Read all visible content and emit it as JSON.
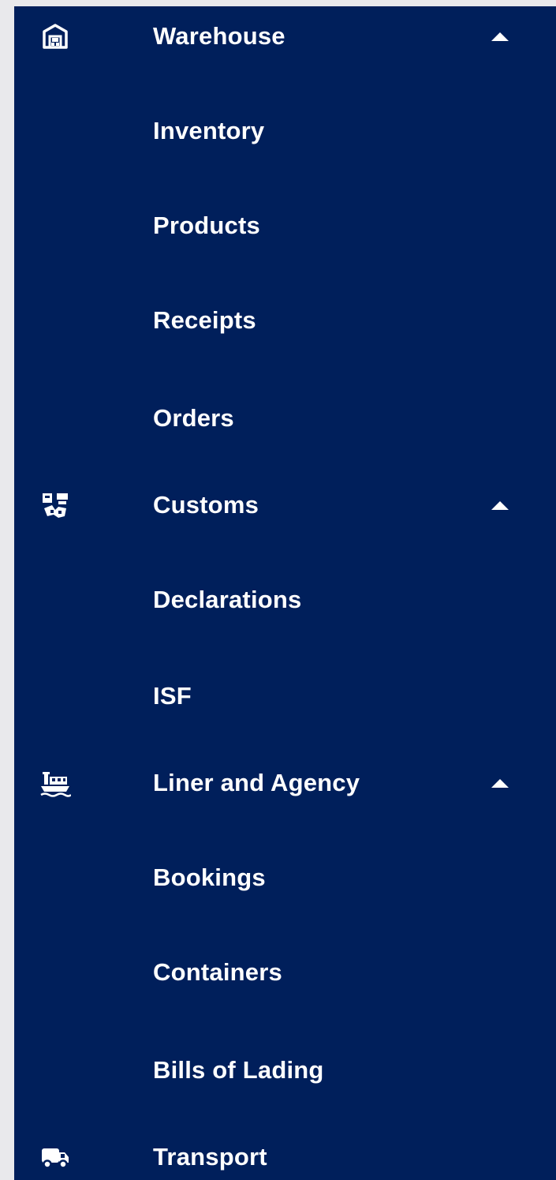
{
  "colors": {
    "panel_background": "#001f5b",
    "page_background": "#e9e9ec",
    "text": "#ffffff"
  },
  "nav": {
    "warehouse": {
      "label": "Warehouse",
      "icon": "warehouse-icon",
      "expanded": true,
      "children": [
        {
          "label": "Inventory"
        },
        {
          "label": "Products"
        },
        {
          "label": "Receipts"
        },
        {
          "label": "Orders"
        }
      ]
    },
    "customs": {
      "label": "Customs",
      "icon": "customs-icon",
      "expanded": true,
      "children": [
        {
          "label": "Declarations"
        },
        {
          "label": "ISF"
        }
      ]
    },
    "liner": {
      "label": "Liner and Agency",
      "icon": "ship-icon",
      "expanded": true,
      "children": [
        {
          "label": "Bookings"
        },
        {
          "label": "Containers"
        },
        {
          "label": "Bills of Lading"
        }
      ]
    },
    "transport": {
      "label": "Transport",
      "icon": "truck-icon"
    }
  }
}
